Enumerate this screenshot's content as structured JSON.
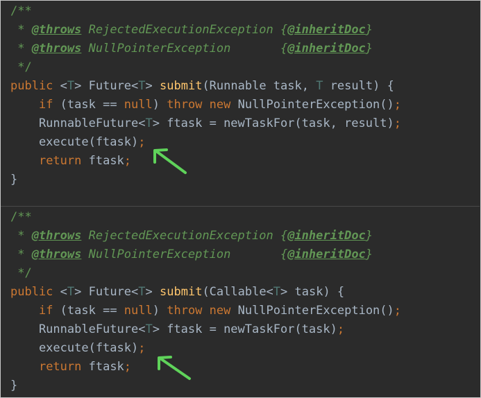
{
  "block1": {
    "lines": [
      {
        "parts": [
          {
            "t": "/**",
            "c": "cm"
          }
        ]
      },
      {
        "parts": [
          {
            "t": " * ",
            "c": "cm"
          },
          {
            "t": "@throws",
            "c": "tag"
          },
          {
            "t": " RejectedExecutionException ",
            "c": "cm it"
          },
          {
            "t": "{",
            "c": "cm it"
          },
          {
            "t": "@inheritDoc",
            "c": "tag"
          },
          {
            "t": "}",
            "c": "cm it"
          }
        ]
      },
      {
        "parts": [
          {
            "t": " * ",
            "c": "cm"
          },
          {
            "t": "@throws",
            "c": "tag"
          },
          {
            "t": " NullPointerException       ",
            "c": "cm it"
          },
          {
            "t": "{",
            "c": "cm it"
          },
          {
            "t": "@inheritDoc",
            "c": "tag"
          },
          {
            "t": "}",
            "c": "cm it"
          }
        ]
      },
      {
        "parts": [
          {
            "t": " */",
            "c": "cm"
          }
        ]
      },
      {
        "parts": [
          {
            "t": "public ",
            "c": "kw"
          },
          {
            "t": "<",
            "c": ""
          },
          {
            "t": "T",
            "c": "tp"
          },
          {
            "t": "> Future<",
            "c": ""
          },
          {
            "t": "T",
            "c": "tp"
          },
          {
            "t": "> ",
            "c": ""
          },
          {
            "t": "submit",
            "c": "fn"
          },
          {
            "t": "(Runnable task, ",
            "c": ""
          },
          {
            "t": "T",
            "c": "tp"
          },
          {
            "t": " result) {",
            "c": ""
          }
        ]
      },
      {
        "parts": [
          {
            "t": "    ",
            "c": ""
          },
          {
            "t": "if",
            "c": "kw"
          },
          {
            "t": " (task == ",
            "c": ""
          },
          {
            "t": "null",
            "c": "kw"
          },
          {
            "t": ") ",
            "c": ""
          },
          {
            "t": "throw new",
            "c": "kw"
          },
          {
            "t": " NullPointerException()",
            "c": ""
          },
          {
            "t": ";",
            "c": "kw"
          }
        ]
      },
      {
        "parts": [
          {
            "t": "    RunnableFuture<",
            "c": ""
          },
          {
            "t": "T",
            "c": "tp"
          },
          {
            "t": "> ftask = newTaskFor(task, result)",
            "c": ""
          },
          {
            "t": ";",
            "c": "kw"
          }
        ]
      },
      {
        "parts": [
          {
            "t": "    execute(ftask)",
            "c": ""
          },
          {
            "t": ";",
            "c": "kw"
          }
        ]
      },
      {
        "parts": [
          {
            "t": "    ",
            "c": ""
          },
          {
            "t": "return",
            "c": "kw"
          },
          {
            "t": " ftask",
            "c": ""
          },
          {
            "t": ";",
            "c": "kw"
          }
        ]
      },
      {
        "parts": [
          {
            "t": "}",
            "c": ""
          }
        ]
      }
    ]
  },
  "block2": {
    "lines": [
      {
        "parts": [
          {
            "t": "/**",
            "c": "cm"
          }
        ]
      },
      {
        "parts": [
          {
            "t": " * ",
            "c": "cm"
          },
          {
            "t": "@throws",
            "c": "tag"
          },
          {
            "t": " RejectedExecutionException ",
            "c": "cm it"
          },
          {
            "t": "{",
            "c": "cm it"
          },
          {
            "t": "@inheritDoc",
            "c": "tag"
          },
          {
            "t": "}",
            "c": "cm it"
          }
        ]
      },
      {
        "parts": [
          {
            "t": " * ",
            "c": "cm"
          },
          {
            "t": "@throws",
            "c": "tag"
          },
          {
            "t": " NullPointerException       ",
            "c": "cm it"
          },
          {
            "t": "{",
            "c": "cm it"
          },
          {
            "t": "@inheritDoc",
            "c": "tag"
          },
          {
            "t": "}",
            "c": "cm it"
          }
        ]
      },
      {
        "parts": [
          {
            "t": " */",
            "c": "cm"
          }
        ]
      },
      {
        "parts": [
          {
            "t": "public ",
            "c": "kw"
          },
          {
            "t": "<",
            "c": ""
          },
          {
            "t": "T",
            "c": "tp"
          },
          {
            "t": "> Future<",
            "c": ""
          },
          {
            "t": "T",
            "c": "tp"
          },
          {
            "t": "> ",
            "c": ""
          },
          {
            "t": "submit",
            "c": "fn"
          },
          {
            "t": "(Callable<",
            "c": ""
          },
          {
            "t": "T",
            "c": "tp"
          },
          {
            "t": "> task) {",
            "c": ""
          }
        ]
      },
      {
        "parts": [
          {
            "t": "    ",
            "c": ""
          },
          {
            "t": "if",
            "c": "kw"
          },
          {
            "t": " (task == ",
            "c": ""
          },
          {
            "t": "null",
            "c": "kw"
          },
          {
            "t": ") ",
            "c": ""
          },
          {
            "t": "throw new",
            "c": "kw"
          },
          {
            "t": " NullPointerException()",
            "c": ""
          },
          {
            "t": ";",
            "c": "kw"
          }
        ]
      },
      {
        "parts": [
          {
            "t": "    RunnableFuture<",
            "c": ""
          },
          {
            "t": "T",
            "c": "tp"
          },
          {
            "t": "> ftask = newTaskFor(task)",
            "c": ""
          },
          {
            "t": ";",
            "c": "kw"
          }
        ]
      },
      {
        "parts": [
          {
            "t": "    execute(ftask)",
            "c": ""
          },
          {
            "t": ";",
            "c": "kw"
          }
        ]
      },
      {
        "parts": [
          {
            "t": "    ",
            "c": ""
          },
          {
            "t": "return",
            "c": "kw"
          },
          {
            "t": " ftask",
            "c": ""
          },
          {
            "t": ";",
            "c": "kw"
          }
        ]
      },
      {
        "parts": [
          {
            "t": "}",
            "c": ""
          }
        ]
      }
    ]
  },
  "colors": {
    "background": "#2b2b2b",
    "text": "#a9b7c6",
    "keyword": "#cc7832",
    "comment": "#629755",
    "method": "#ffc66d",
    "type_param": "#507874",
    "arrow": "#5fd35a"
  },
  "annotations": {
    "arrow_icon": "green-arrow-icon"
  }
}
